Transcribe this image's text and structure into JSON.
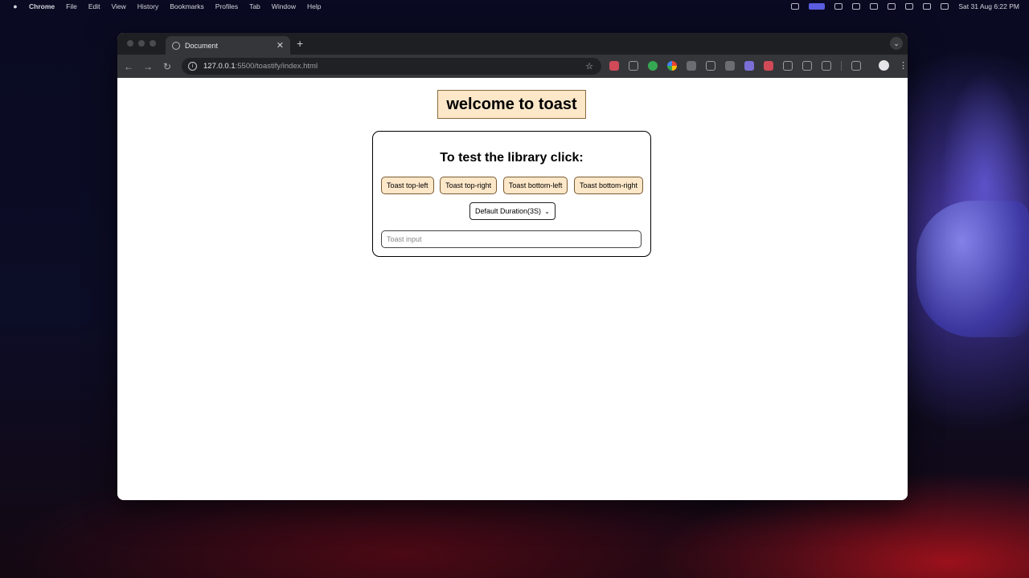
{
  "menubar": {
    "app_name": "Chrome",
    "items": [
      "File",
      "Edit",
      "View",
      "History",
      "Bookmarks",
      "Profiles",
      "Tab",
      "Window",
      "Help"
    ],
    "clock": "Sat 31 Aug  6:22 PM"
  },
  "browser": {
    "tab_title": "Document",
    "url_host": "127.0.0.1",
    "url_path": ":5500/toastify/index.html"
  },
  "page": {
    "title": "welcome to toast",
    "card_heading": "To test the library click:",
    "buttons": [
      "Toast top-left",
      "Toast top-right",
      "Toast bottom-left",
      "Toast bottom-right"
    ],
    "duration_selected": "Default Duration(3S)",
    "input_placeholder": "Toast input"
  },
  "colors": {
    "button_bg": "#fde7c9",
    "title_bg": "#fde7c9"
  }
}
